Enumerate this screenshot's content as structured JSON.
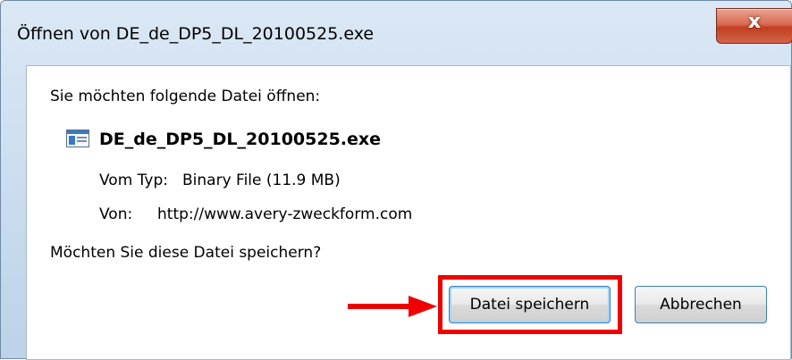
{
  "window": {
    "title": "Öffnen von DE_de_DP5_DL_20100525.exe"
  },
  "titlebar": {
    "close_icon": "close-icon",
    "close_label": "x"
  },
  "dialog": {
    "prompt": "Sie möchten folgende Datei öffnen:",
    "file": {
      "icon": "exe-file-icon",
      "name": "DE_de_DP5_DL_20100525.exe"
    },
    "type_label": "Vom Typ:",
    "type_value": "Binary File (11.9 MB)",
    "from_label": "Von:",
    "from_value": "http://www.avery-zweckform.com",
    "question": "Möchten Sie diese Datei speichern?"
  },
  "buttons": {
    "save_label": "Datei speichern",
    "cancel_label": "Abbrechen"
  },
  "annotation": {
    "color": "#ee0000",
    "arrow_icon": "arrow-right-icon"
  }
}
